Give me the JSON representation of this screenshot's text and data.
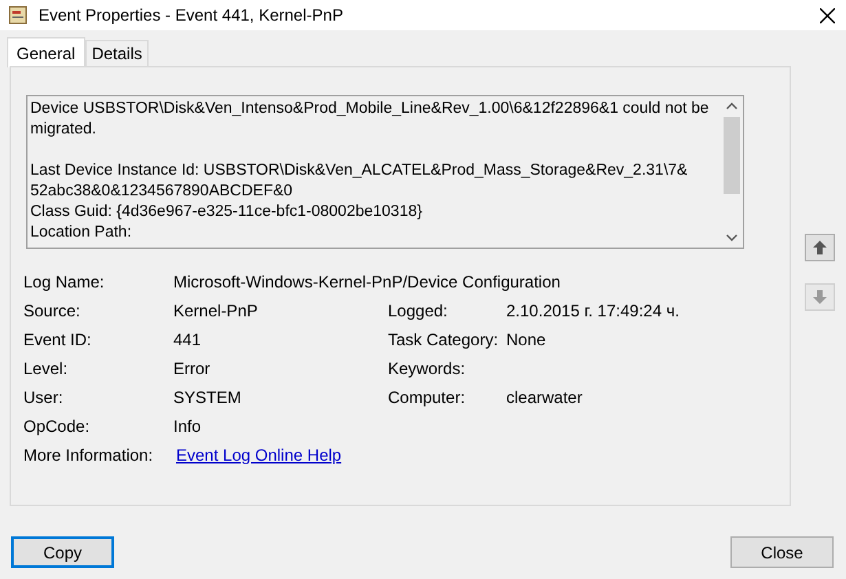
{
  "window": {
    "title": "Event Properties - Event 441, Kernel-PnP"
  },
  "tabs": [
    {
      "label": "General",
      "selected": true
    },
    {
      "label": "Details",
      "selected": false
    }
  ],
  "description": [
    [
      "Device USBSTOR\\Disk&Ven_Intenso&Prod_Mobile_Line&Rev_1.00\\6&12f22896&1 could not be",
      "migrated."
    ],
    [
      "Last Device Instance Id: USBSTOR\\Disk&Ven_ALCATEL&Prod_Mass_Storage&Rev_2.31\\7&",
      "52abc38&0&1234567890ABCDEF&0",
      "Class Guid: {4d36e967-e325-11ce-bfc1-08002be10318}",
      "Location Path:"
    ]
  ],
  "rows": [
    {
      "label": "Log Name:",
      "value": "Microsoft-Windows-Kernel-PnP/Device Configuration"
    },
    {
      "label": "Source:",
      "value": "Kernel-PnP",
      "label_2": "Logged:",
      "value_2": "2.10.2015 г. 17:49:24 ч."
    },
    {
      "label": "Event ID:",
      "value": "441",
      "label_2": "Task Category:",
      "value_2": "None"
    },
    {
      "label": "Level:",
      "value": "Error",
      "label_2": "Keywords:"
    },
    {
      "label": "User:",
      "value": "SYSTEM",
      "label_2": "Computer:",
      "value_2": "clearwater"
    },
    {
      "label": "OpCode:",
      "value": "Info"
    },
    {
      "label": "More Information:",
      "link": "Event Log Online Help"
    }
  ],
  "buttons": [
    {
      "label": "Copy",
      "focused": true
    },
    {
      "label": "Close",
      "focused": false
    }
  ]
}
